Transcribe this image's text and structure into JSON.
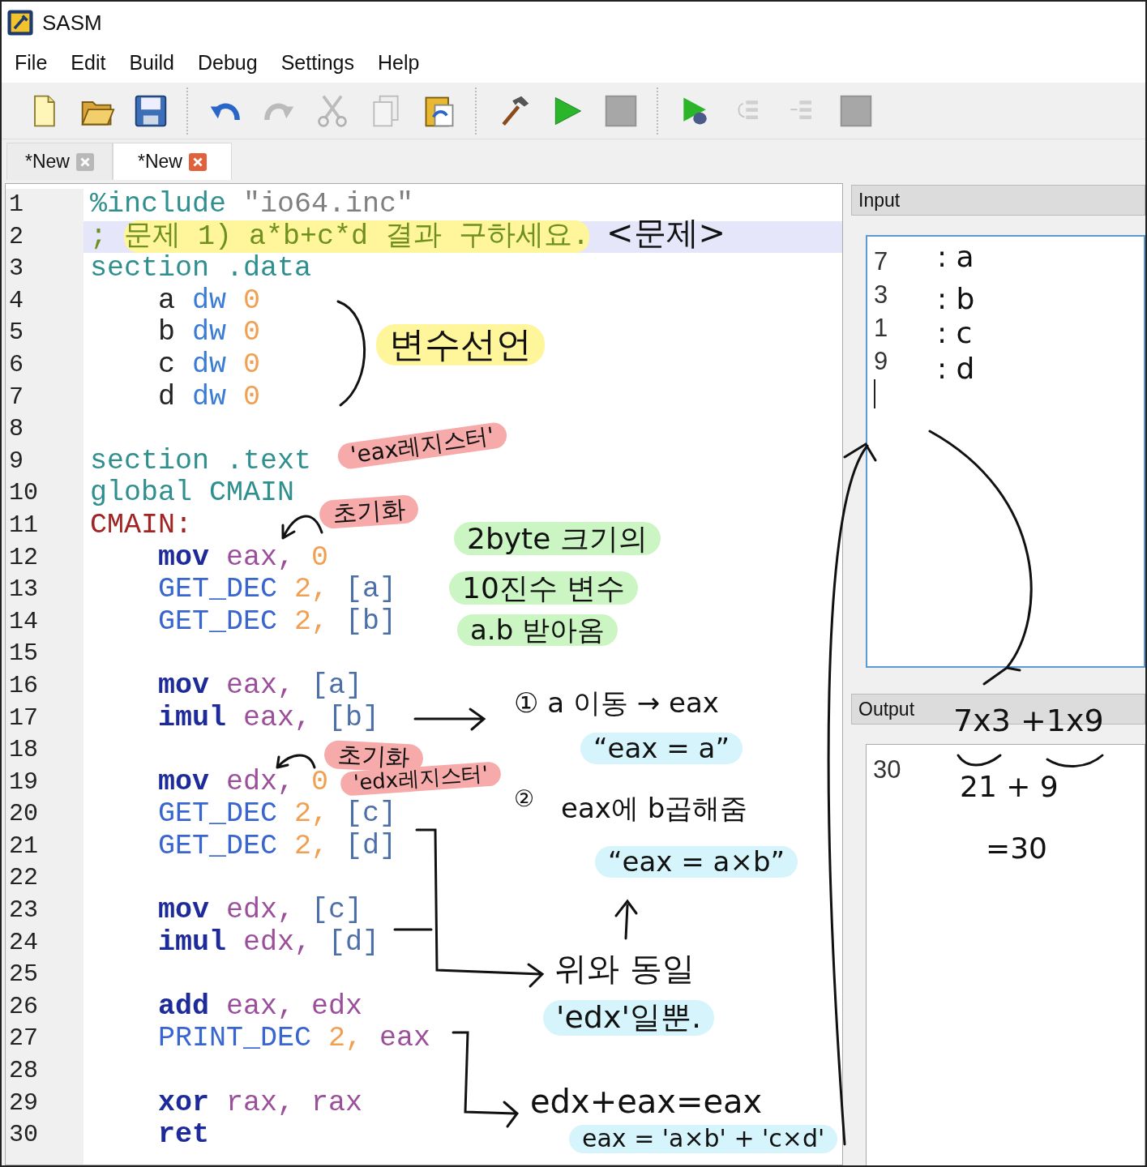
{
  "window": {
    "title": "SASM"
  },
  "menu": [
    "File",
    "Edit",
    "Build",
    "Debug",
    "Settings",
    "Help"
  ],
  "toolbar": [
    {
      "kind": "new",
      "disabled": false
    },
    {
      "kind": "open",
      "disabled": false
    },
    {
      "kind": "save",
      "disabled": false
    },
    {
      "kind": "separator"
    },
    {
      "kind": "undo",
      "disabled": false
    },
    {
      "kind": "redo",
      "disabled": true
    },
    {
      "kind": "cut",
      "disabled": true
    },
    {
      "kind": "copy",
      "disabled": true
    },
    {
      "kind": "paste",
      "disabled": false
    },
    {
      "kind": "separator"
    },
    {
      "kind": "build",
      "disabled": false
    },
    {
      "kind": "run",
      "disabled": false
    },
    {
      "kind": "stop",
      "disabled": true
    },
    {
      "kind": "separator"
    },
    {
      "kind": "debug",
      "disabled": false
    },
    {
      "kind": "step-into",
      "disabled": true
    },
    {
      "kind": "step-over",
      "disabled": true
    },
    {
      "kind": "stop",
      "disabled": true
    }
  ],
  "tabs": [
    {
      "label": "*New",
      "selected": false
    },
    {
      "label": "*New",
      "selected": true
    }
  ],
  "editor": {
    "lines": [
      {
        "number": "1",
        "current": false,
        "tokens": [
          {
            "kind": "directive",
            "text": "%include"
          },
          {
            "kind": "string",
            "text": "\"io64.inc\""
          }
        ]
      },
      {
        "number": "2",
        "current": true,
        "tokens": [
          {
            "kind": "comment",
            "text": ";"
          },
          {
            "kind": "comment",
            "text": "문제 1) a*b+c*d 결과 구하세요.",
            "marked": true
          }
        ]
      },
      {
        "number": "3",
        "current": false,
        "tokens": [
          {
            "kind": "directive",
            "text": "section .data"
          }
        ]
      },
      {
        "number": "4",
        "current": false,
        "indented": true,
        "tokens": [
          {
            "kind": "plain",
            "text": "a"
          },
          {
            "kind": "type",
            "text": "dw"
          },
          {
            "kind": "number",
            "text": "0"
          }
        ]
      },
      {
        "number": "5",
        "current": false,
        "indented": true,
        "tokens": [
          {
            "kind": "plain",
            "text": "b"
          },
          {
            "kind": "type",
            "text": "dw"
          },
          {
            "kind": "number",
            "text": "0"
          }
        ]
      },
      {
        "number": "6",
        "current": false,
        "indented": true,
        "tokens": [
          {
            "kind": "plain",
            "text": "c"
          },
          {
            "kind": "type",
            "text": "dw"
          },
          {
            "kind": "number",
            "text": "0"
          }
        ]
      },
      {
        "number": "7",
        "current": false,
        "indented": true,
        "tokens": [
          {
            "kind": "plain",
            "text": "d"
          },
          {
            "kind": "type",
            "text": "dw"
          },
          {
            "kind": "number",
            "text": "0"
          }
        ]
      },
      {
        "number": "8",
        "current": false
      },
      {
        "number": "9",
        "current": false,
        "tokens": [
          {
            "kind": "directive",
            "text": "section .text"
          }
        ]
      },
      {
        "number": "10",
        "current": false,
        "tokens": [
          {
            "kind": "directive",
            "text": "global CMAIN"
          }
        ]
      },
      {
        "number": "11",
        "current": false,
        "tokens": [
          {
            "kind": "label",
            "text": "CMAIN:"
          }
        ]
      },
      {
        "number": "12",
        "current": false,
        "indented": true,
        "tokens": [
          {
            "kind": "instruction",
            "text": "mov"
          },
          {
            "kind": "register",
            "text": "eax,"
          },
          {
            "kind": "number",
            "text": "0"
          }
        ]
      },
      {
        "number": "13",
        "current": false,
        "indented": true,
        "tokens": [
          {
            "kind": "macro",
            "text": "GET_DEC"
          },
          {
            "kind": "number",
            "text": "2,"
          },
          {
            "kind": "memory",
            "text": "[a]"
          }
        ]
      },
      {
        "number": "14",
        "current": false,
        "indented": true,
        "tokens": [
          {
            "kind": "macro",
            "text": "GET_DEC"
          },
          {
            "kind": "number",
            "text": "2,"
          },
          {
            "kind": "memory",
            "text": "[b]"
          }
        ]
      },
      {
        "number": "15",
        "current": false
      },
      {
        "number": "16",
        "current": false,
        "indented": true,
        "tokens": [
          {
            "kind": "instruction",
            "text": "mov"
          },
          {
            "kind": "register",
            "text": "eax,"
          },
          {
            "kind": "memory",
            "text": "[a]"
          }
        ]
      },
      {
        "number": "17",
        "current": false,
        "indented": true,
        "tokens": [
          {
            "kind": "instruction",
            "text": "imul"
          },
          {
            "kind": "register",
            "text": "eax,"
          },
          {
            "kind": "memory",
            "text": "[b]"
          }
        ]
      },
      {
        "number": "18",
        "current": false
      },
      {
        "number": "19",
        "current": false,
        "indented": true,
        "tokens": [
          {
            "kind": "instruction",
            "text": "mov"
          },
          {
            "kind": "register",
            "text": "edx,"
          },
          {
            "kind": "number",
            "text": "0"
          }
        ]
      },
      {
        "number": "20",
        "current": false,
        "indented": true,
        "tokens": [
          {
            "kind": "macro",
            "text": "GET_DEC"
          },
          {
            "kind": "number",
            "text": "2,"
          },
          {
            "kind": "memory",
            "text": "[c]"
          }
        ]
      },
      {
        "number": "21",
        "current": false,
        "indented": true,
        "tokens": [
          {
            "kind": "macro",
            "text": "GET_DEC"
          },
          {
            "kind": "number",
            "text": "2,"
          },
          {
            "kind": "memory",
            "text": "[d]"
          }
        ]
      },
      {
        "number": "22",
        "current": false
      },
      {
        "number": "23",
        "current": false,
        "indented": true,
        "tokens": [
          {
            "kind": "instruction",
            "text": "mov"
          },
          {
            "kind": "register",
            "text": "edx,"
          },
          {
            "kind": "memory",
            "text": "[c]"
          }
        ]
      },
      {
        "number": "24",
        "current": false,
        "indented": true,
        "tokens": [
          {
            "kind": "instruction",
            "text": "imul"
          },
          {
            "kind": "register",
            "text": "edx,"
          },
          {
            "kind": "memory",
            "text": "[d]"
          }
        ]
      },
      {
        "number": "25",
        "current": false
      },
      {
        "number": "26",
        "current": false,
        "indented": true,
        "tokens": [
          {
            "kind": "instruction",
            "text": "add"
          },
          {
            "kind": "register",
            "text": "eax,"
          },
          {
            "kind": "register",
            "text": "edx"
          }
        ]
      },
      {
        "number": "27",
        "current": false,
        "indented": true,
        "tokens": [
          {
            "kind": "macro",
            "text": "PRINT_DEC"
          },
          {
            "kind": "number",
            "text": "2,"
          },
          {
            "kind": "register",
            "text": "eax"
          }
        ]
      },
      {
        "number": "28",
        "current": false
      },
      {
        "number": "29",
        "current": false,
        "indented": true,
        "tokens": [
          {
            "kind": "instruction",
            "text": "xor"
          },
          {
            "kind": "register",
            "text": "rax,"
          },
          {
            "kind": "register",
            "text": "rax"
          }
        ]
      },
      {
        "number": "30",
        "current": false,
        "indented": true,
        "tokens": [
          {
            "kind": "instruction",
            "text": "ret"
          }
        ]
      }
    ]
  },
  "input_panel": {
    "title": "Input",
    "lines": [
      "7",
      "3",
      "1",
      "9"
    ]
  },
  "output_panel": {
    "title": "Output",
    "lines": [
      "30"
    ]
  },
  "annotations": [
    {
      "text": "<문제>"
    },
    {
      "text": "변수선언",
      "color": "#fff59a"
    },
    {
      "text": "'eax레지스터'",
      "color": "#f7aaaa"
    },
    {
      "text": "초기화",
      "color": "#f7aaaa"
    },
    {
      "text": "2byte 크기의",
      "color": "#ccf5c4"
    },
    {
      "text": "10진수 변수",
      "color": "#ccf5c4"
    },
    {
      "text": "a.b 받아옴",
      "color": "#ccf5c4"
    },
    {
      "text": "① a 이동 → eax"
    },
    {
      "text": "“eax = a”",
      "color": "#d6f4fb"
    },
    {
      "text": "초기화",
      "color": "#f7aaaa"
    },
    {
      "text": "'edx레지스터'",
      "color": "#f7aaaa"
    },
    {
      "text": "②"
    },
    {
      "text": "eax에 b곱해줌"
    },
    {
      "text": "“eax = a×b”",
      "color": "#d6f4fb"
    },
    {
      "text": "위와 동일"
    },
    {
      "text": "'edx'일뿐.",
      "color": "#d6f4fb"
    },
    {
      "text": "edx+eax=eax"
    },
    {
      "text": "eax = 'a×b' + 'c×d'",
      "color": "#d6f4fb"
    },
    {
      "text": ": a"
    },
    {
      "text": ": b"
    },
    {
      "text": ": c"
    },
    {
      "text": ": d"
    },
    {
      "text": "7x3 +1x9"
    },
    {
      "text": "21 + 9"
    },
    {
      "text": "=30"
    }
  ]
}
